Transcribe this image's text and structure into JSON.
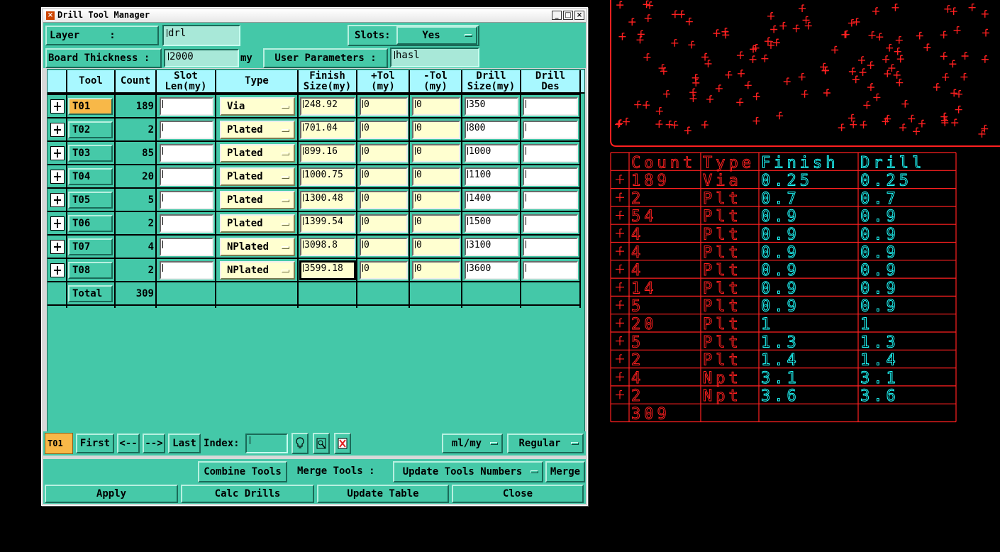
{
  "window": {
    "title": "Drill Tool Manager"
  },
  "header": {
    "layer_label": "Layer     :",
    "layer_value": "drl",
    "slots_label": "Slots:",
    "slots_value": "Yes",
    "board_thickness_label": "Board Thickness :",
    "board_thickness_value": "2000",
    "board_thickness_unit": "my",
    "user_params_label": "User Parameters :",
    "user_params_value": "hasl"
  },
  "table": {
    "columns": [
      "Tool",
      "Count",
      "Slot Len(my)",
      "Type",
      "Finish Size(my)",
      "+Tol (my)",
      "-Tol (my)",
      "Drill Size(my)",
      "Drill Des"
    ],
    "rows": [
      {
        "tool": "T01",
        "count": "189",
        "type": "Via",
        "finish": "248.92",
        "ptol": "0",
        "mtol": "0",
        "drill": "350"
      },
      {
        "tool": "T02",
        "count": "2",
        "type": "Plated",
        "finish": "701.04",
        "ptol": "0",
        "mtol": "0",
        "drill": "800"
      },
      {
        "tool": "T03",
        "count": "85",
        "type": "Plated",
        "finish": "899.16",
        "ptol": "0",
        "mtol": "0",
        "drill": "1000"
      },
      {
        "tool": "T04",
        "count": "20",
        "type": "Plated",
        "finish": "1000.75",
        "ptol": "0",
        "mtol": "0",
        "drill": "1100"
      },
      {
        "tool": "T05",
        "count": "5",
        "type": "Plated",
        "finish": "1300.48",
        "ptol": "0",
        "mtol": "0",
        "drill": "1400"
      },
      {
        "tool": "T06",
        "count": "2",
        "type": "Plated",
        "finish": "1399.54",
        "ptol": "0",
        "mtol": "0",
        "drill": "1500"
      },
      {
        "tool": "T07",
        "count": "4",
        "type": "NPlated",
        "finish": "3098.8",
        "ptol": "0",
        "mtol": "0",
        "drill": "3100"
      },
      {
        "tool": "T08",
        "count": "2",
        "type": "NPlated",
        "finish": "3599.18",
        "ptol": "0",
        "mtol": "0",
        "drill": "3600"
      }
    ],
    "total_label": "Total",
    "total_count": "309"
  },
  "nav": {
    "current_tool": "T01",
    "first": "First",
    "prev": "<--",
    "next": "-->",
    "last": "Last",
    "index_label": "Index:",
    "index_value": "",
    "units": "ml/my",
    "mode": "Regular"
  },
  "actions": {
    "combine_tools": "Combine Tools",
    "merge_tools_label": "Merge Tools :",
    "merge_tools_select": "Update Tools Numbers",
    "merge": "Merge",
    "apply": "Apply",
    "calc_drills": "Calc Drills",
    "update_table": "Update Table",
    "close": "Close"
  },
  "cad": {
    "colors": {
      "background": "#000000",
      "frame": "#ff2020",
      "table_text_red": "#ff2020",
      "table_text_cyan": "#20ffff"
    },
    "table_headers": [
      "Count",
      "Type",
      "Finish",
      "Drill"
    ],
    "table_rows": [
      [
        "189",
        "Via",
        "0.25",
        "0.25"
      ],
      [
        "2",
        "Plt",
        "0.7",
        "0.7"
      ],
      [
        "54",
        "Plt",
        "0.9",
        "0.9"
      ],
      [
        "4",
        "Plt",
        "0.9",
        "0.9"
      ],
      [
        "4",
        "Plt",
        "0.9",
        "0.9"
      ],
      [
        "4",
        "Plt",
        "0.9",
        "0.9"
      ],
      [
        "14",
        "Plt",
        "0.9",
        "0.9"
      ],
      [
        "5",
        "Plt",
        "0.9",
        "0.9"
      ],
      [
        "20",
        "Plt",
        "1",
        "1"
      ],
      [
        "5",
        "Plt",
        "1.3",
        "1.3"
      ],
      [
        "2",
        "Plt",
        "1.4",
        "1.4"
      ],
      [
        "4",
        "Npt",
        "3.1",
        "3.1"
      ],
      [
        "2",
        "Npt",
        "3.6",
        "3.6"
      ]
    ],
    "table_total": "309"
  }
}
